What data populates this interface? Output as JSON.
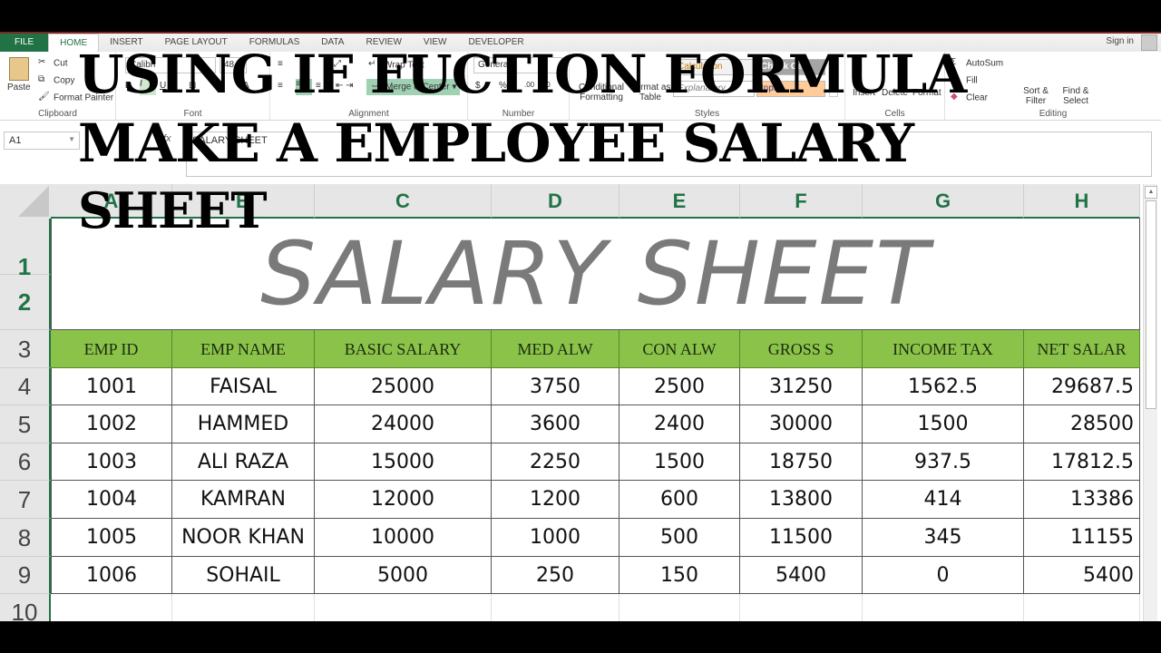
{
  "overlay": {
    "line1": "USING IF FUCTION FORMULA",
    "line2": "MAKE A EMPLOYEE SALARY",
    "line3": "SHEET"
  },
  "ribbon_tabs": [
    "FILE",
    "HOME",
    "INSERT",
    "PAGE LAYOUT",
    "FORMULAS",
    "DATA",
    "REVIEW",
    "VIEW",
    "DEVELOPER"
  ],
  "active_tab": "HOME",
  "sign_in": "Sign in",
  "ribbon": {
    "clipboard": {
      "paste": "Paste",
      "cut": "Cut",
      "copy": "Copy",
      "format_painter": "Format Painter",
      "label": "Clipboard"
    },
    "font": {
      "name": "Calibri",
      "size": "48",
      "label": "Font"
    },
    "alignment": {
      "wrap_text": "Wrap Text",
      "merge_center": "Merge & Center",
      "label": "Alignment"
    },
    "number": {
      "format": "General",
      "currency": "$",
      "percent": "%",
      "label": "Number"
    },
    "styles": {
      "conditional": "Conditional Formatting",
      "format_table": "Format as Table",
      "explanation": "Explanatory ...",
      "calculation": "Calculation",
      "check_cell": "Check Cell",
      "input": "Input",
      "label": "Styles"
    },
    "cells": {
      "insert": "Insert",
      "delete": "Delete",
      "format": "Format",
      "label": "Cells"
    },
    "editing": {
      "autosum": "AutoSum",
      "fill": "Fill",
      "clear": "Clear",
      "sort_filter": "Sort & Filter",
      "find_select": "Find & Select",
      "label": "Editing"
    }
  },
  "formula_bar": {
    "name_box": "A1",
    "fx": "fx",
    "content": "SALARY SHEET"
  },
  "columns": [
    "A",
    "B",
    "C",
    "D",
    "E",
    "F",
    "G",
    "H"
  ],
  "rows": [
    "1",
    "2",
    "3",
    "4",
    "5",
    "6",
    "7",
    "8",
    "9",
    "10"
  ],
  "sheet_title": "SALARY SHEET",
  "table": {
    "headers": [
      "EMP ID",
      "EMP NAME",
      "BASIC SALARY",
      "MED ALW",
      "CON ALW",
      "GROSS S",
      "INCOME TAX",
      "NET SALAR"
    ],
    "rows": [
      [
        "1001",
        "FAISAL",
        "25000",
        "3750",
        "2500",
        "31250",
        "1562.5",
        "29687.5"
      ],
      [
        "1002",
        "HAMMED",
        "24000",
        "3600",
        "2400",
        "30000",
        "1500",
        "28500"
      ],
      [
        "1003",
        "ALI RAZA",
        "15000",
        "2250",
        "1500",
        "18750",
        "937.5",
        "17812.5"
      ],
      [
        "1004",
        "KAMRAN",
        "12000",
        "1200",
        "600",
        "13800",
        "414",
        "13386"
      ],
      [
        "1005",
        "NOOR KHAN",
        "10000",
        "1000",
        "500",
        "11500",
        "345",
        "11155"
      ],
      [
        "1006",
        "SOHAIL",
        "5000",
        "250",
        "150",
        "5400",
        "0",
        "5400"
      ]
    ]
  },
  "colors": {
    "excel_green": "#217346",
    "header_fill": "#8bc34a",
    "title_gray": "#7a7a7a"
  }
}
